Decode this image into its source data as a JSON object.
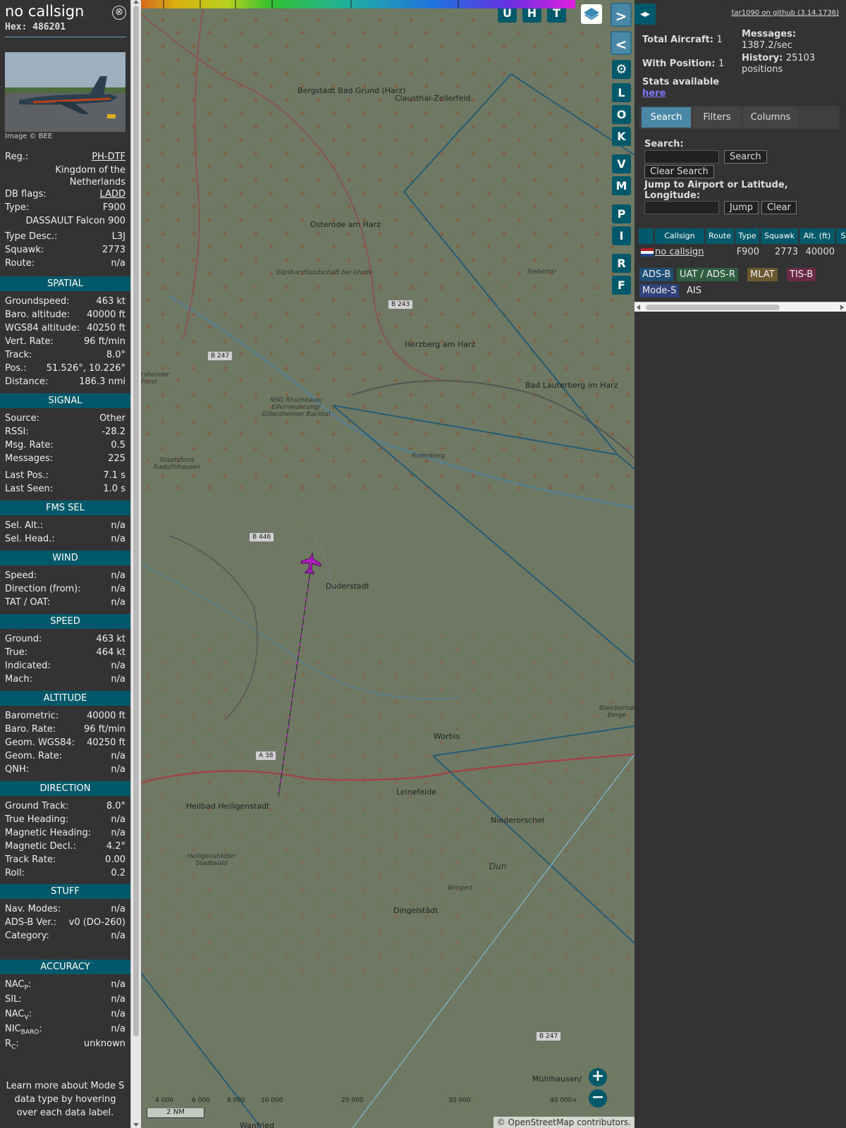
{
  "info": {
    "callsign": "no callsign",
    "hex_label": "Hex:",
    "hex": "486201",
    "close": "⊗",
    "photo_credit": "Image © BEE",
    "rows1": [
      {
        "label": "Reg.:",
        "value": "PH-DTF"
      },
      {
        "label": "",
        "value": "Kingdom of the"
      },
      {
        "label": "",
        "value": "Netherlands"
      },
      {
        "label": "DB flags:",
        "value": "LADD"
      },
      {
        "label": "Type:",
        "value": "F900"
      },
      {
        "label": "",
        "value": "DASSAULT Falcon 900"
      },
      {
        "label": "Type Desc.:",
        "value": "L3J"
      },
      {
        "label": "Squawk:",
        "value": "2773"
      },
      {
        "label": "Route:",
        "value": "n/a"
      }
    ],
    "spatial": {
      "title": "SPATIAL",
      "rows": [
        {
          "label": "Groundspeed:",
          "value": "463 kt"
        },
        {
          "label": "Baro. altitude:",
          "value": "40000 ft"
        },
        {
          "label": "WGS84 altitude:",
          "value": "40250 ft"
        },
        {
          "label": "Vert. Rate:",
          "value": "96 ft/min"
        },
        {
          "label": "Track:",
          "value": "8.0°"
        },
        {
          "label": "Pos.:",
          "value": "51.526°, 10.226°"
        },
        {
          "label": "Distance:",
          "value": "186.3 nmi"
        }
      ]
    },
    "signal": {
      "title": "SIGNAL",
      "rows": [
        {
          "label": "Source:",
          "value": "Other"
        },
        {
          "label": "RSSI:",
          "value": "-28.2"
        },
        {
          "label": "Msg. Rate:",
          "value": "0.5"
        },
        {
          "label": "Messages:",
          "value": "225"
        },
        {
          "label": "Last Pos.:",
          "value": "7.1 s"
        },
        {
          "label": "Last Seen:",
          "value": "1.0 s"
        }
      ]
    },
    "fms": {
      "title": "FMS SEL",
      "rows": [
        {
          "label": "Sel. Alt.:",
          "value": "n/a"
        },
        {
          "label": "Sel. Head.:",
          "value": "n/a"
        }
      ]
    },
    "wind": {
      "title": "WIND",
      "rows": [
        {
          "label": "Speed:",
          "value": "n/a"
        },
        {
          "label": "Direction (from):",
          "value": "n/a"
        },
        {
          "label": "TAT / OAT:",
          "value": "n/a"
        }
      ]
    },
    "speed": {
      "title": "SPEED",
      "rows": [
        {
          "label": "Ground:",
          "value": "463 kt"
        },
        {
          "label": "True:",
          "value": "464 kt"
        },
        {
          "label": "Indicated:",
          "value": "n/a"
        },
        {
          "label": "Mach:",
          "value": "n/a"
        }
      ]
    },
    "altitude": {
      "title": "ALTITUDE",
      "rows": [
        {
          "label": "Barometric:",
          "value": "40000 ft"
        },
        {
          "label": "Baro. Rate:",
          "value": "96 ft/min"
        },
        {
          "label": "Geom. WGS84:",
          "value": "40250 ft"
        },
        {
          "label": "Geom. Rate:",
          "value": "n/a"
        },
        {
          "label": "QNH:",
          "value": "n/a"
        }
      ]
    },
    "direction": {
      "title": "DIRECTION",
      "rows": [
        {
          "label": "Ground Track:",
          "value": "8.0°"
        },
        {
          "label": "True Heading:",
          "value": "n/a"
        },
        {
          "label": "Magnetic Heading:",
          "value": "n/a"
        },
        {
          "label": "Magnetic Decl.:",
          "value": "4.2°"
        },
        {
          "label": "Track Rate:",
          "value": "0.00"
        },
        {
          "label": "Roll:",
          "value": "0.2"
        }
      ]
    },
    "stuff": {
      "title": "STUFF",
      "rows": [
        {
          "label": "Nav. Modes:",
          "value": "n/a"
        },
        {
          "label": "ADS-B Ver.:",
          "value": "v0 (DO-260)"
        },
        {
          "label": "Category:",
          "value": "n/a"
        }
      ]
    },
    "accuracy": {
      "title": "ACCURACY",
      "rows": [
        {
          "label": "NAC",
          "sub": "P",
          "value": "n/a"
        },
        {
          "label": "SIL:",
          "sub": "",
          "value": "n/a"
        },
        {
          "label": "NAC",
          "sub": "V",
          "value": "n/a"
        },
        {
          "label": "NIC",
          "sub": "BARO",
          "value": "n/a"
        },
        {
          "label": "R",
          "sub": "C",
          "value": "unknown"
        }
      ]
    },
    "footer": "Learn more about Mode S data type by hovering over each data label."
  },
  "map": {
    "buttons_top": [
      "U",
      "H",
      "T"
    ],
    "buttons_side": [
      "L",
      "O",
      "K",
      "V",
      "M",
      "P",
      "I",
      "R",
      "F"
    ],
    "nav_next": ">",
    "nav_prev": "<",
    "settings_icon": "⚙",
    "zoom_in": "+",
    "zoom_out": "−",
    "scale": "2 NM",
    "attribution": "© OpenStreetMap contributors.",
    "altitude_ticks": [
      "4 000",
      "6 000",
      "8 000",
      "10 000",
      "20 000",
      "30 000",
      "40 000+"
    ],
    "places": [
      {
        "name": "Bergstadt Bad Grund (Harz)",
        "style": "town"
      },
      {
        "name": "Clausthal-Zellerfeld",
        "style": "town"
      },
      {
        "name": "Osterode am Harz",
        "style": "town"
      },
      {
        "name": "Gipskarstlandschaft bei Uhrde",
        "style": "nature"
      },
      {
        "name": "Sieberta!",
        "style": "nature"
      },
      {
        "name": "Herzberg am Harz",
        "style": "town"
      },
      {
        "name": "Bad Lauterberg im Harz",
        "style": "town"
      },
      {
        "name": "NSG Rhumeaue/ Ellerniederung/ Gillersheimer Bachtal",
        "style": "nature"
      },
      {
        "name": "Rotenberg",
        "style": "nature"
      },
      {
        "name": "Staatsforst Radolfshausen",
        "style": "nature"
      },
      {
        "name": "rsheimer Forst",
        "style": "nature"
      },
      {
        "name": "Duderstadt",
        "style": "town"
      },
      {
        "name": "Worbis",
        "style": "town"
      },
      {
        "name": "Bleicherode Berge",
        "style": "nature"
      },
      {
        "name": "Heilbad Heiligenstadt",
        "style": "town"
      },
      {
        "name": "Leinefelde",
        "style": "town"
      },
      {
        "name": "Niederorschel",
        "style": "town"
      },
      {
        "name": "Heiligenstädter Stadtwald",
        "style": "nature"
      },
      {
        "name": "Dun",
        "style": "nature"
      },
      {
        "name": "Wingert",
        "style": "nature"
      },
      {
        "name": "Dingelstädt",
        "style": "town"
      },
      {
        "name": "Mühlhausen/",
        "style": "town"
      },
      {
        "name": "Wanfried",
        "style": "town"
      }
    ],
    "roads": [
      "B 243",
      "B 247",
      "B 446",
      "A 38",
      "B 247"
    ]
  },
  "right": {
    "toggle": "◂▸",
    "github": "tar1090 on github (3.14.1736)",
    "total_aircraft_label": "Total Aircraft:",
    "total_aircraft": "1",
    "with_position_label": "With Position:",
    "with_position": "1",
    "messages_label": "Messages:",
    "messages": "1387.2/sec",
    "history_label": "History:",
    "history": "25103 positions",
    "stats_label": "Stats available",
    "stats_link": "here",
    "tabs": [
      "Search",
      "Filters",
      "Columns"
    ],
    "search_label": "Search:",
    "search_button": "Search",
    "clear_search": "Clear Search",
    "jump_label": "Jump to Airport or Latitude, Longitude:",
    "jump_button": "Jump",
    "clear_button": "Clear",
    "table_headers": [
      "Callsign",
      "Route",
      "Type",
      "Squawk",
      "Alt. (ft)",
      "S"
    ],
    "table_row": {
      "callsign": "no callsign",
      "route": "",
      "type": "F900",
      "squawk": "2773",
      "alt": "40000"
    },
    "legend": [
      {
        "label": "ADS-B",
        "color": "#1f4f75"
      },
      {
        "label": "UAT / ADS-R",
        "color": "#2f5f3f"
      },
      {
        "label": "MLAT",
        "color": "#6b5a2f"
      },
      {
        "label": "TIS-B",
        "color": "#6b2a45"
      },
      {
        "label": "Mode-S",
        "color": "#30427a"
      },
      {
        "label": "AIS",
        "color": "#333333"
      }
    ]
  }
}
